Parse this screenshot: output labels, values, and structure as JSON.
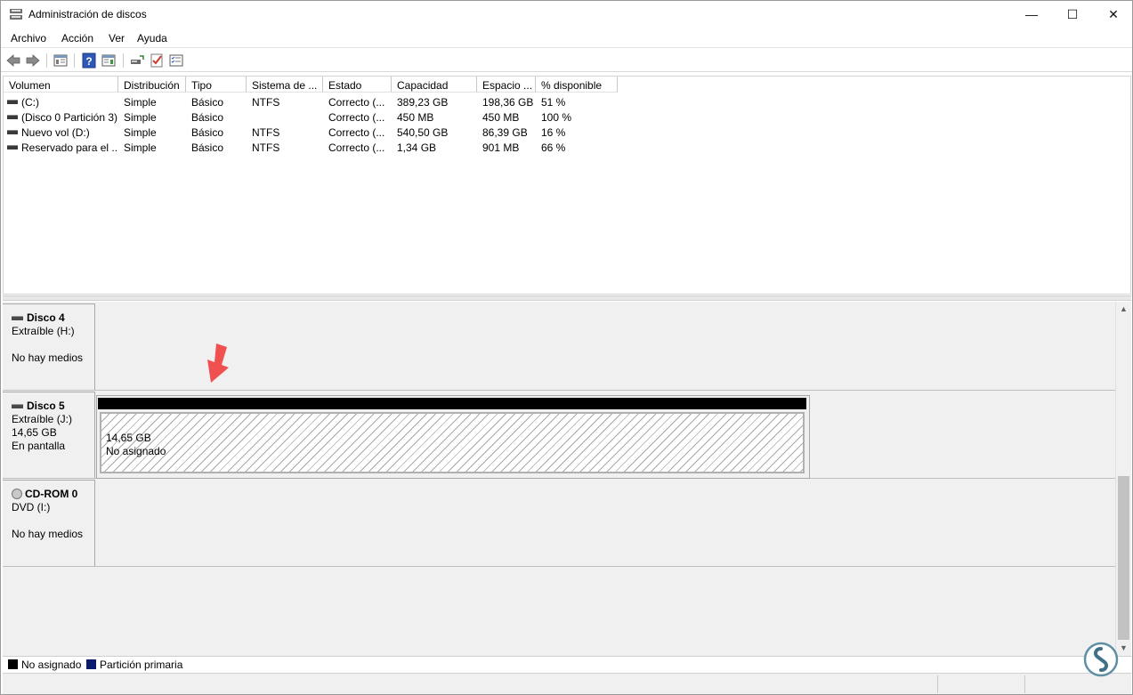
{
  "window": {
    "title": "Administración de discos",
    "controls": {
      "minimize": "—",
      "maximize": "☐",
      "close": "✕"
    }
  },
  "menu": [
    "Archivo",
    "Acción",
    "Ver",
    "Ayuda"
  ],
  "toolbar": {
    "icons": [
      "back-arrow-icon",
      "forward-arrow-icon",
      "show-hide-console-tree-icon",
      "help-icon",
      "show-hide-action-pane-icon",
      "connect-drive-icon",
      "check-icon",
      "properties-list-icon"
    ]
  },
  "volume_table": {
    "columns": [
      "Volumen",
      "Distribución",
      "Tipo",
      "Sistema de ...",
      "Estado",
      "Capacidad",
      "Espacio ...",
      "% disponible"
    ],
    "rows": [
      [
        "(C:)",
        "Simple",
        "Básico",
        "NTFS",
        "Correcto (...",
        "389,23 GB",
        "198,36 GB",
        "51 %"
      ],
      [
        "(Disco 0 Partición 3)",
        "Simple",
        "Básico",
        "",
        "Correcto (...",
        "450 MB",
        "450 MB",
        "100 %"
      ],
      [
        "Nuevo vol (D:)",
        "Simple",
        "Básico",
        "NTFS",
        "Correcto (...",
        "540,50 GB",
        "86,39 GB",
        "16 %"
      ],
      [
        "Reservado para el ...",
        "Simple",
        "Básico",
        "NTFS",
        "Correcto (...",
        "1,34 GB",
        "901 MB",
        "66 %"
      ]
    ]
  },
  "disks": [
    {
      "name": "Disco 4",
      "line1": "Extraíble (H:)",
      "line2": "",
      "line3": "No hay medios"
    },
    {
      "name": "Disco 5",
      "line1": "Extraíble (J:)",
      "line2": "14,65 GB",
      "line3": "En pantalla",
      "partition": {
        "size": "14,65 GB",
        "status": "No asignado"
      }
    },
    {
      "name": "CD-ROM 0",
      "line1": "DVD (I:)",
      "line2": "",
      "line3": "No hay medios"
    }
  ],
  "legend": [
    {
      "label": "No asignado",
      "color": "#000000"
    },
    {
      "label": "Partición primaria",
      "color": "#0a1a6e"
    }
  ],
  "colors": {
    "arrow": "#f0504f",
    "unallocated": "#000000",
    "primary_partition": "#0a1a6e"
  }
}
